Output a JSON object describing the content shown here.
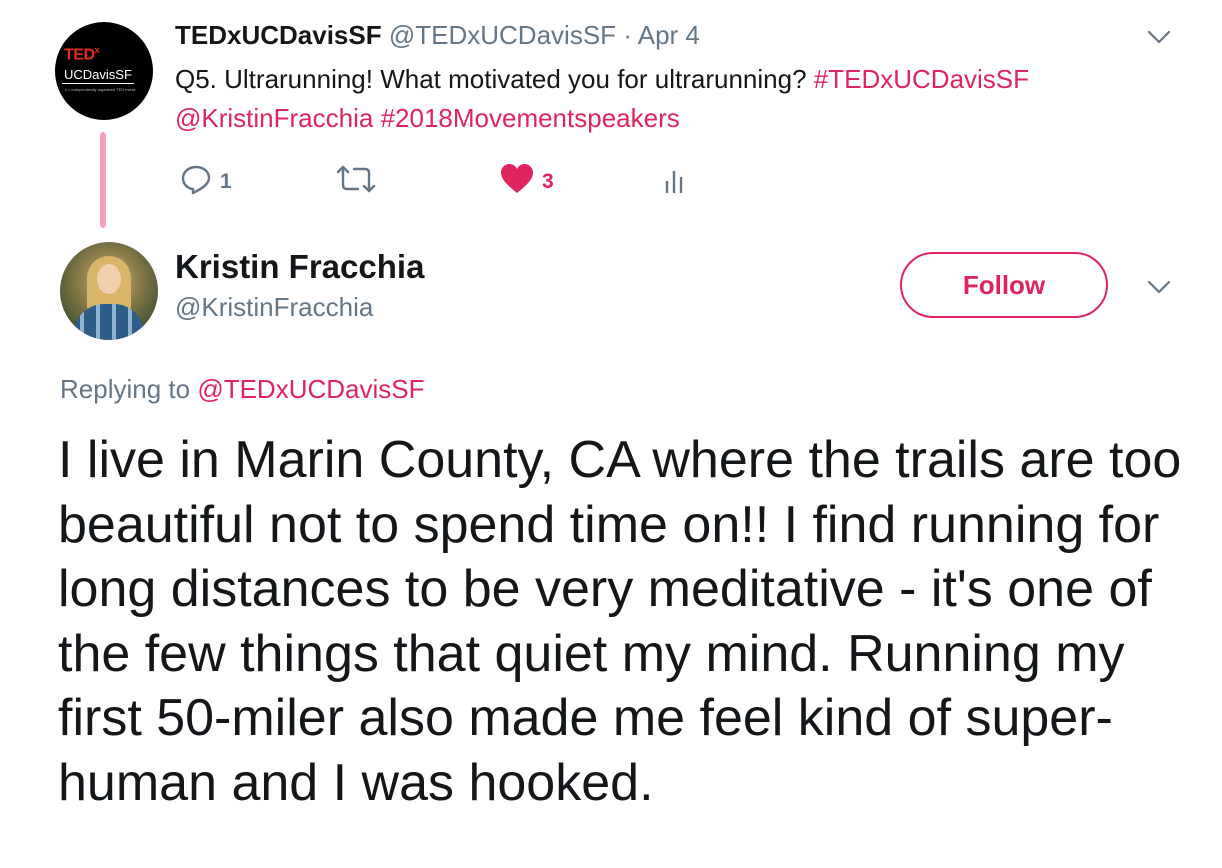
{
  "colors": {
    "accent": "#e0245e",
    "muted": "#657786",
    "text": "#14171a",
    "thread_line": "#f5a3bd"
  },
  "parent_tweet": {
    "avatar": {
      "logo_top": "TED",
      "logo_sup": "x",
      "logo_name": "UCDavisSF",
      "logo_tagline": "x = independently organized TED event"
    },
    "display_name": "TEDxUCDavisSF",
    "handle": "@TEDxUCDavisSF",
    "separator": "·",
    "date": "Apr 4",
    "text": "Q5. Ultrarunning! What motivated you for ultrarunning?",
    "hashtag_1": "#TEDxUCDavisSF",
    "mention": "@KristinFracchia",
    "hashtag_2": "#2018Movementspeakers",
    "reply_count": "1",
    "like_count": "3",
    "icons": {
      "reply": "reply-icon",
      "retweet": "retweet-icon",
      "like": "heart-icon",
      "analytics": "analytics-icon",
      "menu": "chevron-down-icon"
    }
  },
  "reply_tweet": {
    "display_name": "Kristin Fracchia",
    "handle": "@KristinFracchia",
    "follow_label": "Follow",
    "replying_prefix": "Replying to",
    "replying_to": "@TEDxUCDavisSF",
    "text": "I live in Marin County, CA where the trails are too beautiful not to spend time on!! I find running for long distances to be very meditative - it's one of the few things that quiet my mind. Running my first 50-miler also made me feel kind of super-human and I was hooked."
  }
}
